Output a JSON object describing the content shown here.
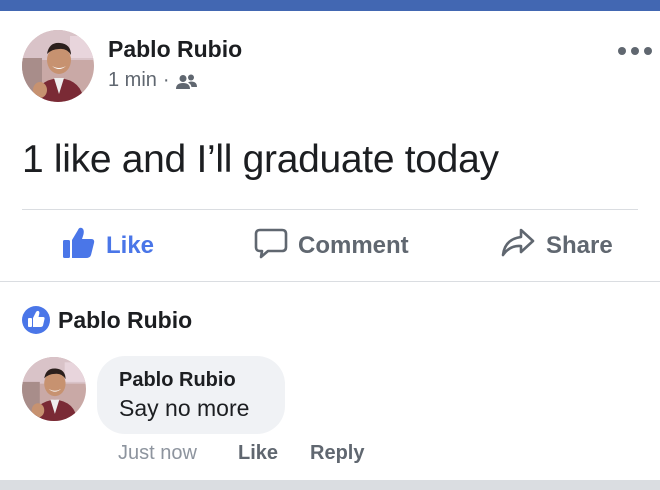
{
  "colors": {
    "brand_bar": "#4267b2",
    "like_blue": "#4a76e8",
    "text_primary": "#1c1e21",
    "text_secondary": "#606770",
    "bubble_bg": "#f0f2f5"
  },
  "post": {
    "author": "Pablo Rubio",
    "time": "1 min",
    "separator": "·",
    "audience_icon": "friends-icon",
    "text": "1 like and I’ll graduate today",
    "more_icon": "more-options-icon"
  },
  "actions": {
    "like_label": "Like",
    "comment_label": "Comment",
    "share_label": "Share"
  },
  "reactions": {
    "icon": "like-badge-icon",
    "names": "Pablo Rubio"
  },
  "comment": {
    "author": "Pablo Rubio",
    "text": "Say no more",
    "time": "Just now",
    "like_label": "Like",
    "reply_label": "Reply"
  }
}
